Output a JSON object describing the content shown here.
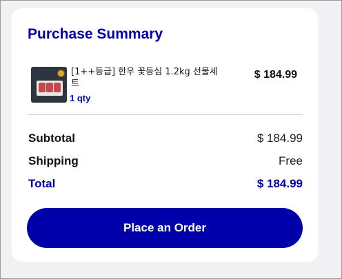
{
  "summary": {
    "title": "Purchase Summary"
  },
  "item": {
    "name": "[1++등급] 한우 꽃등심 1.2kg 선물세트",
    "qty": "1 qty",
    "price": "$ 184.99"
  },
  "totals": {
    "subtotal_label": "Subtotal",
    "subtotal_value": "$ 184.99",
    "shipping_label": "Shipping",
    "shipping_value": "Free",
    "total_label": "Total",
    "total_value": "$ 184.99"
  },
  "actions": {
    "place_order_label": "Place an Order"
  },
  "colors": {
    "accent": "#0000aa",
    "background": "#f1f1f3",
    "card": "#ffffff"
  }
}
